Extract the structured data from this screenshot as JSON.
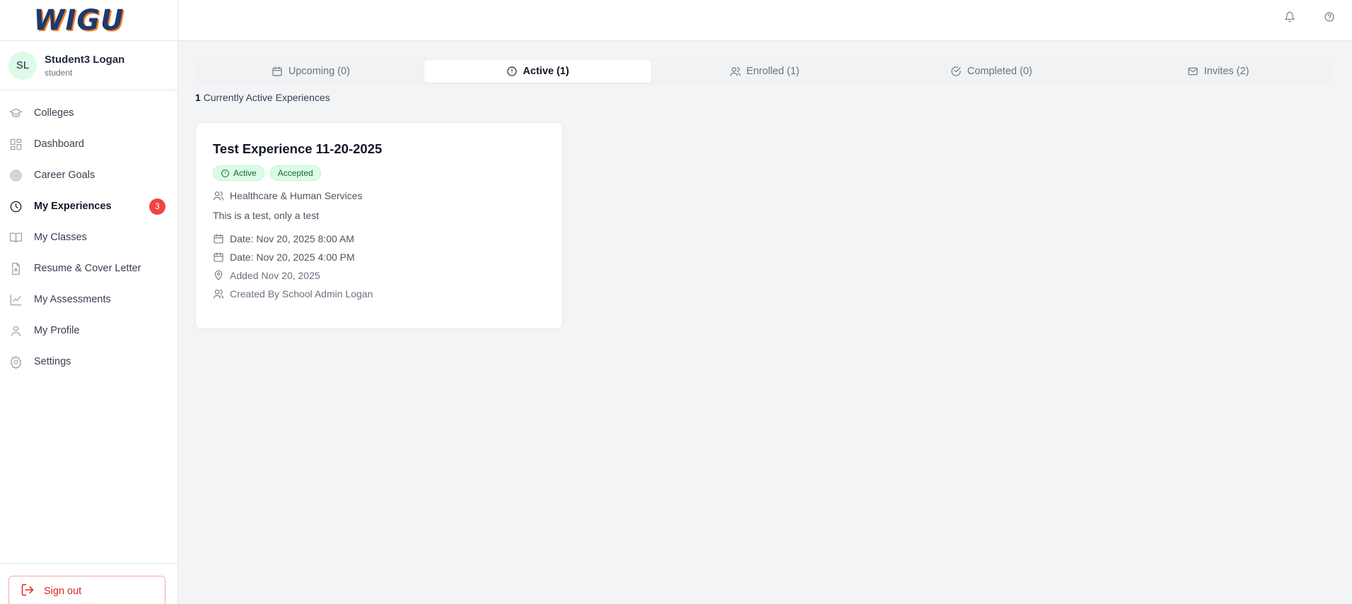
{
  "brand": {
    "logo_text": "WIGU"
  },
  "user": {
    "initials": "SL",
    "name": "Student3 Logan",
    "role": "student"
  },
  "sidebar": {
    "items": [
      {
        "label": "Colleges",
        "icon": "graduation-cap-icon"
      },
      {
        "label": "Dashboard",
        "icon": "dashboard-grid-icon"
      },
      {
        "label": "Career Goals",
        "icon": "target-icon"
      },
      {
        "label": "My Experiences",
        "icon": "clock-icon",
        "active": true,
        "badge": "3"
      },
      {
        "label": "My Classes",
        "icon": "book-icon"
      },
      {
        "label": "Resume & Cover Letter",
        "icon": "document-icon"
      },
      {
        "label": "My Assessments",
        "icon": "line-chart-icon"
      },
      {
        "label": "My Profile",
        "icon": "user-icon"
      },
      {
        "label": "Settings",
        "icon": "gear-icon"
      }
    ],
    "signout_label": "Sign out"
  },
  "topbar": {
    "icons": [
      "bell-icon",
      "help-icon"
    ]
  },
  "tabs": [
    {
      "label": "Upcoming (0)",
      "icon": "calendar-icon"
    },
    {
      "label": "Active (1)",
      "icon": "alert-circle-icon",
      "active": true
    },
    {
      "label": "Enrolled (1)",
      "icon": "users-icon"
    },
    {
      "label": "Completed (0)",
      "icon": "check-circle-icon"
    },
    {
      "label": "Invites (2)",
      "icon": "mail-icon"
    }
  ],
  "summary": {
    "count": "1",
    "text": "Currently Active Experiences"
  },
  "experience": {
    "title": "Test Experience 11-20-2025",
    "badges": [
      "Active",
      "Accepted"
    ],
    "category": "Healthcare & Human Services",
    "description": "This is a test, only a test",
    "start": "Date: Nov 20, 2025 8:00 AM",
    "end": "Date: Nov 20, 2025 4:00 PM",
    "added": "Added Nov 20, 2025",
    "created_by": "Created By School Admin Logan"
  },
  "colors": {
    "accent_green_bg": "#dcfce7",
    "accent_green_text": "#166534",
    "badge_red": "#ef4444",
    "signout_red": "#dc2626",
    "logo_blue": "#1e3a6e",
    "logo_orange": "#f07c1f"
  }
}
